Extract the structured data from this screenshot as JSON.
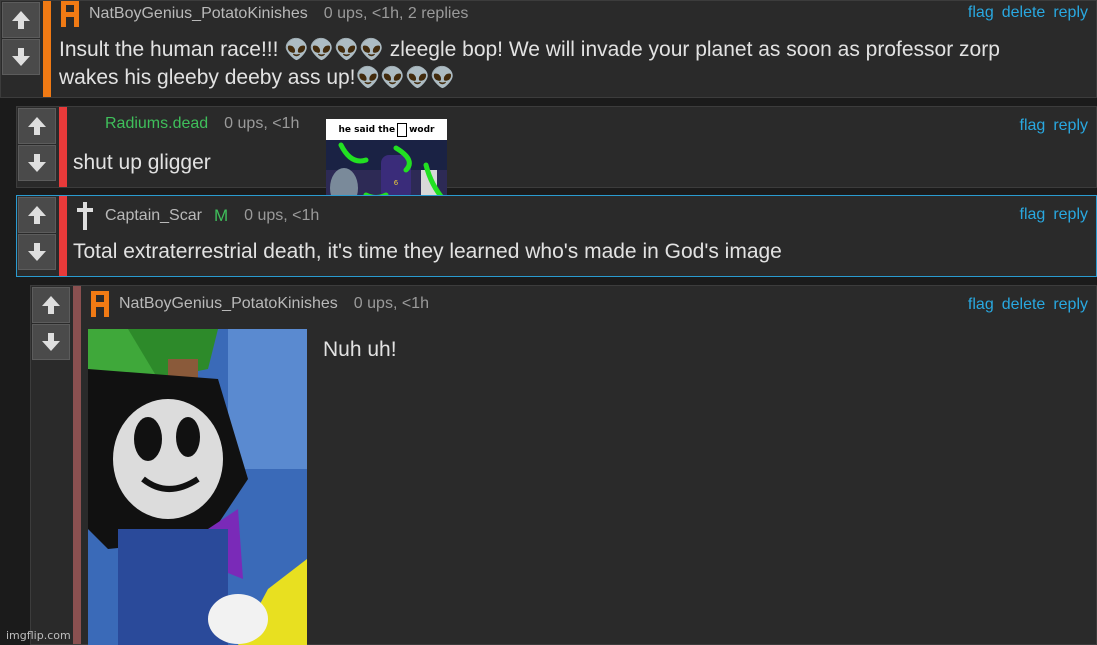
{
  "comments": [
    {
      "username": "NatBoyGenius_PotatoKinishes",
      "stats": "0 ups, <1h, 2 replies",
      "actions": [
        "flag",
        "delete",
        "reply"
      ],
      "line1_a": "Insult the human race!!! ",
      "line1_b": " zleegle bop! We will invade your planet as soon as professor zorp",
      "line2": "wakes his gleeby deeby ass up!",
      "bar_color": "#f07a14"
    },
    {
      "username": "Radiums.dead",
      "stats": "0 ups, <1h",
      "actions": [
        "flag",
        "reply"
      ],
      "text": "shut up gligger",
      "image_caption": "he said the",
      "image_caption_b": "wodr",
      "bar_color": "#e83a3a"
    },
    {
      "username": "Captain_Scar",
      "mod_badge": "M",
      "stats": "0 ups, <1h",
      "actions": [
        "flag",
        "reply"
      ],
      "text": "Total extraterrestrial death, it's time they learned who's made in God's image",
      "bar_color": "#e83a3a"
    },
    {
      "username": "NatBoyGenius_PotatoKinishes",
      "stats": "0 ups, <1h",
      "actions": [
        "flag",
        "delete",
        "reply"
      ],
      "text": "Nuh uh!",
      "bar_color": "#8a5050"
    }
  ],
  "emoji": "👽",
  "watermark": "imgflip.com",
  "colors": {
    "link": "#29a8e0",
    "username_green": "#3fbf5b",
    "badge_orange": "#f07a14"
  }
}
